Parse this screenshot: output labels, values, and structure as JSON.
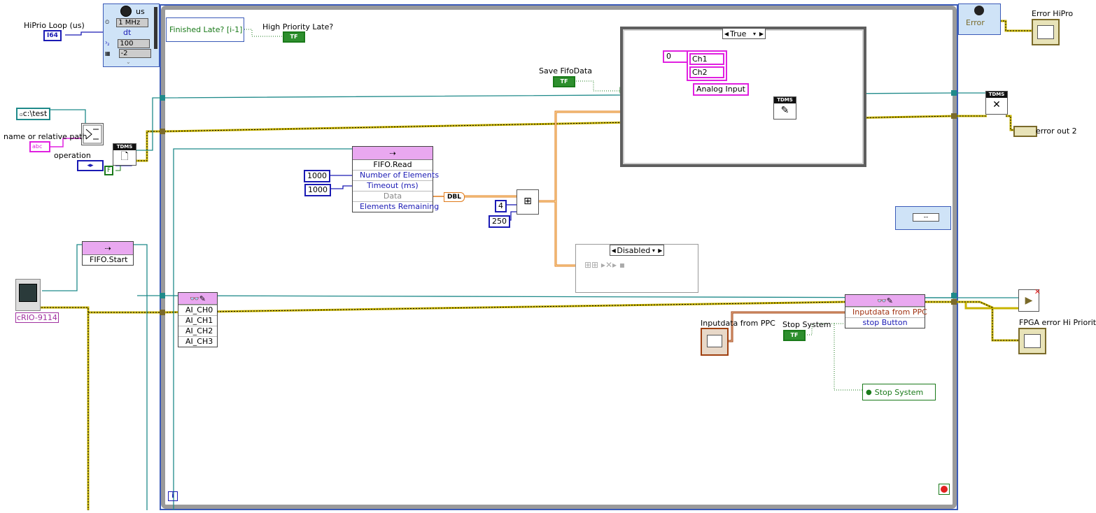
{
  "timed_loop": {
    "clock_label": "us",
    "frequency": "1 MHz",
    "dt_label": "dt",
    "offset_value": "100",
    "processor_value": "-2"
  },
  "left_inputs": {
    "hiprio_loop_label": "HiPrio Loop (us)",
    "hiprio_loop_type": "I64",
    "path_constant": "c:\\test",
    "name_or_path_label": "name or relative path",
    "operation_label": "operation",
    "false_constant": "F",
    "crio_label": "cRIO-9114"
  },
  "fifo_start": {
    "title": "FIFO.Start"
  },
  "fifo_read": {
    "title": "FIFO.Read",
    "rows": [
      "Number of Elements",
      "Timeout (ms)",
      "Data",
      "Elements Remaining"
    ],
    "num_elements_const": "1000",
    "timeout_const": "1000",
    "dbl_label": "DBL"
  },
  "reshape": {
    "dim1": "4",
    "dim2": "250"
  },
  "finished_late": {
    "label": "Finished Late? [i-1]",
    "indicator_label": "High Priority Late?",
    "bool_text": "TF"
  },
  "save_fifo": {
    "label": "Save FifoData",
    "bool_text": "TF"
  },
  "case_true": {
    "selector": "True",
    "index_const": "0",
    "channels": [
      "Ch1",
      "Ch2"
    ],
    "group_const": "Analog Input"
  },
  "case_disabled": {
    "selector": "Disabled"
  },
  "read_write_left": {
    "rows": [
      "AI_CH0",
      "AI_CH1",
      "AI_CH2",
      "AI_CH3"
    ]
  },
  "read_write_right": {
    "rows": [
      "Inputdata from PPC",
      "stop Button"
    ],
    "input_label": "Inputdata from PPC",
    "stop_label": "Stop System",
    "stop_bool": "TF",
    "stop_property": "Stop System"
  },
  "error_area": {
    "error_left": "Error",
    "error_hipro_label": "Error HiPro",
    "error_out2_label": "error out 2",
    "fpga_error_label": "FPGA error Hi Priority",
    "status_const": "--"
  },
  "tdms_label": "TDMS",
  "loop_iter": "i",
  "colors": {
    "loop_border": "#8a8a8a",
    "error_wire": "#c8b400",
    "numeric_blue": "#1a1ab4",
    "string_pink": "#e020e0",
    "bool_green": "#2e8f2e",
    "fifo_orange": "#e07a1a",
    "refnum_teal": "#1f8a8a"
  }
}
